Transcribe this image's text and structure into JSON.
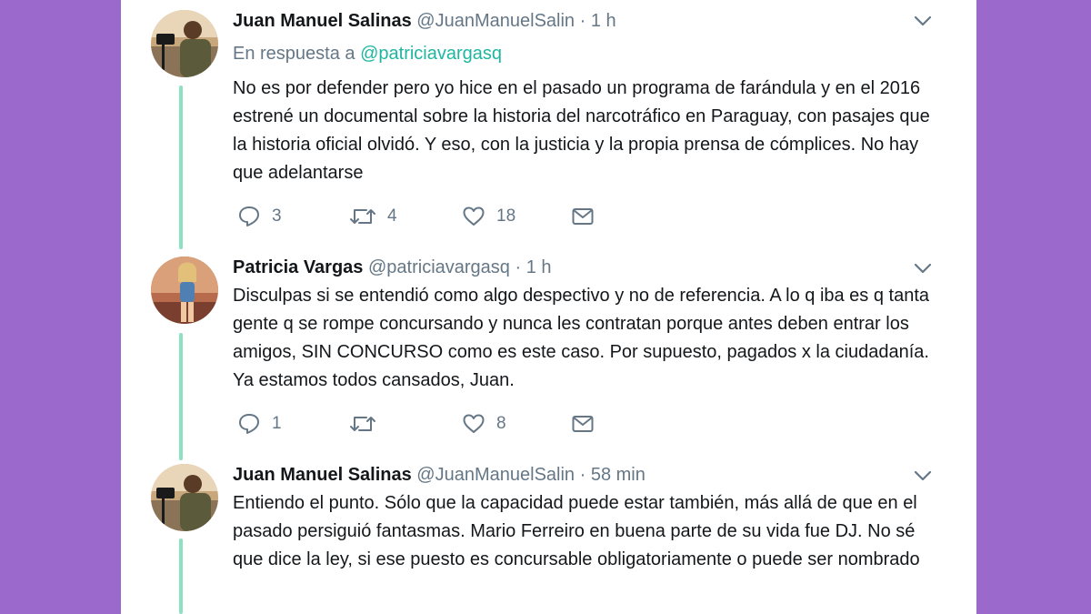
{
  "colors": {
    "backdrop": "#9b68cc",
    "thread_line": "#8ee0c2",
    "mention": "#1fb6a0",
    "secondary_text": "#657786",
    "primary_text": "#14171a"
  },
  "tweets": [
    {
      "name": "Juan Manuel Salinas",
      "handle": "@JuanManuelSalin",
      "time": "· 1 h",
      "reply_prefix": "En respuesta a",
      "reply_mention": "@patriciavargasq",
      "text": "No es por defender pero yo hice en el pasado un programa de farándula y en el 2016 estrené un documental sobre la historia del narcotráfico en Paraguay, con pasajes que la historia oficial olvidó. Y eso, con la justicia y la propia prensa de cómplices. No hay que adelantarse",
      "replies": "3",
      "retweets": "4",
      "likes": "18",
      "icons": [
        "reply-icon",
        "retweet-icon",
        "like-icon",
        "message-icon",
        "chevron-down-icon"
      ]
    },
    {
      "name": "Patricia Vargas",
      "handle": "@patriciavargasq",
      "time": "· 1 h",
      "text": "Disculpas si se entendió como algo despectivo y no de referencia. A lo q iba es q tanta gente q se rompe concursando y nunca les contratan porque antes deben entrar los amigos, SIN CONCURSO como es este caso. Por supuesto, pagados x la ciudadanía. Ya estamos todos cansados, Juan.",
      "replies": "1",
      "retweets": "",
      "likes": "8",
      "icons": [
        "reply-icon",
        "retweet-icon",
        "like-icon",
        "message-icon",
        "chevron-down-icon"
      ]
    },
    {
      "name": "Juan Manuel Salinas",
      "handle": "@JuanManuelSalin",
      "time": "· 58 min",
      "text": "Entiendo el punto. Sólo que la capacidad puede estar también, más allá de que en el pasado persiguió fantasmas. Mario Ferreiro en buena parte de su vida fue DJ. No sé que dice la ley, si ese puesto es concursable obligatoriamente o puede ser nombrado",
      "icons": [
        "chevron-down-icon"
      ]
    }
  ]
}
